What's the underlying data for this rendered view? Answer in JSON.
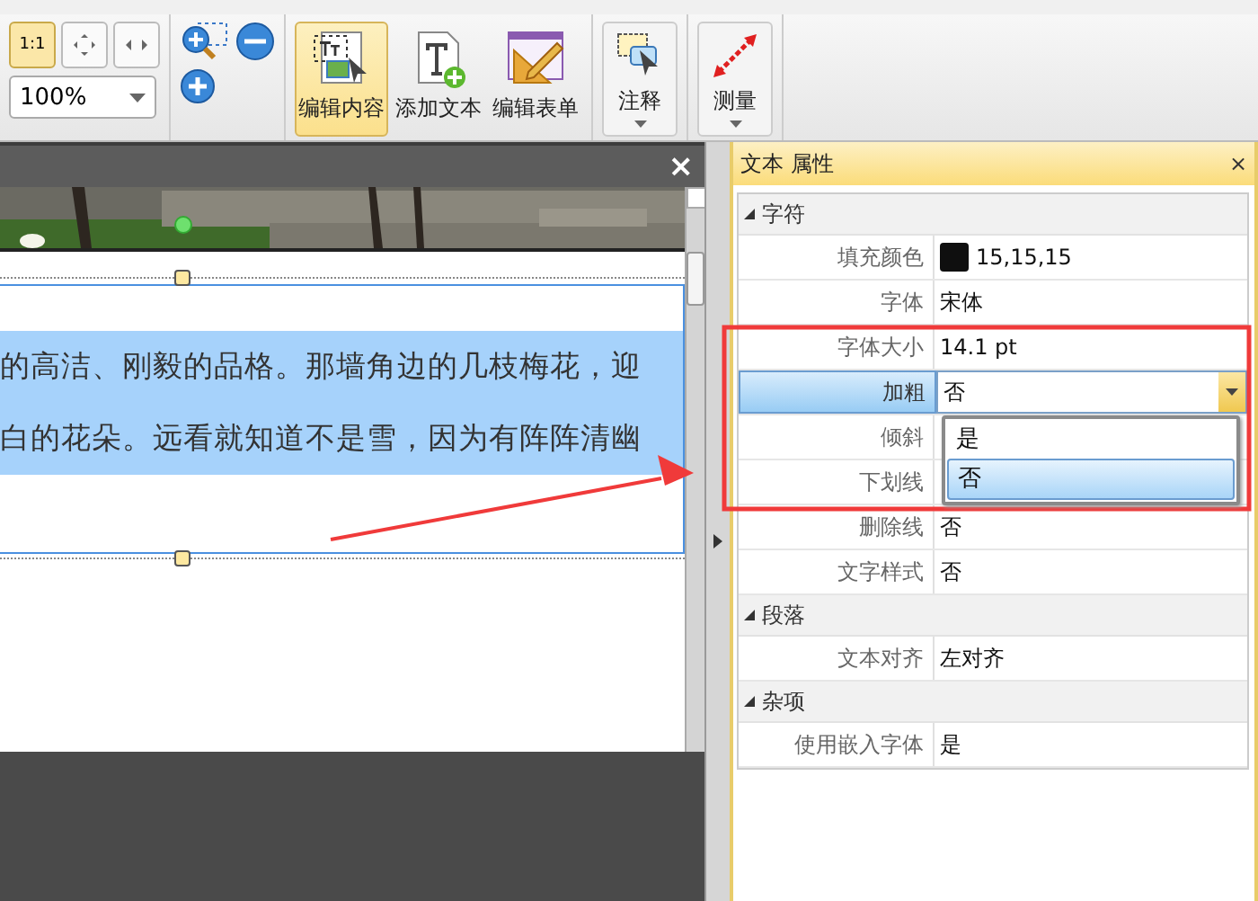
{
  "toolbar": {
    "view_buttons": [
      {
        "kind": "actual",
        "label": "1:1",
        "selected": true
      },
      {
        "kind": "fit",
        "selected": false
      },
      {
        "kind": "width",
        "selected": false
      }
    ],
    "zoom": "100%",
    "buttons": [
      {
        "kind": "edit",
        "label": "编辑内容",
        "selected": true
      },
      {
        "kind": "text",
        "label": "添加文本",
        "selected": false
      },
      {
        "kind": "form",
        "label": "编辑表单",
        "selected": false
      },
      {
        "kind": "comment",
        "label": "注释",
        "selected": false
      },
      {
        "kind": "measure",
        "label": "测量",
        "selected": false
      }
    ]
  },
  "document": {
    "close": "×",
    "lines": [
      "的高洁、刚毅的品格。那墙角边的几枝梅花，迎",
      "白的花朵。远看就知道不是雪，因为有阵阵清幽"
    ]
  },
  "properties": {
    "title": "文本 属性",
    "close": "×",
    "sections": [
      {
        "name": "字符",
        "expanded": true,
        "rows": [
          {
            "label": "填充颜色",
            "value": "15,15,15",
            "color": "#0f0f0f",
            "selected": false
          },
          {
            "label": "字体",
            "value": "宋体",
            "selected": false
          },
          {
            "label": "字体大小",
            "value": "14.1 pt",
            "selected": false
          },
          {
            "label": "加粗",
            "value": "否",
            "selected": true,
            "options": [
              {
                "label": "是",
                "selected": false
              },
              {
                "label": "否",
                "selected": true
              }
            ]
          },
          {
            "label": "倾斜",
            "selected": false
          },
          {
            "label": "下划线",
            "selected": false
          },
          {
            "label": "删除线",
            "value": "否",
            "selected": false
          },
          {
            "label": "文字样式",
            "value": "否",
            "selected": false
          }
        ]
      },
      {
        "name": "段落",
        "expanded": true,
        "rows": [
          {
            "label": "文本对齐",
            "value": "左对齐",
            "selected": false
          }
        ]
      },
      {
        "name": "杂项",
        "expanded": true,
        "rows": [
          {
            "label": "使用嵌入字体",
            "value": "是",
            "selected": false
          }
        ]
      }
    ]
  }
}
